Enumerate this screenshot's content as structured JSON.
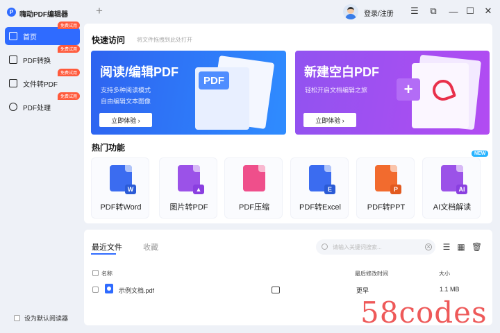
{
  "app": {
    "title": "嗨动PDF编辑器",
    "logo_glyph": "P",
    "new_tab": "+"
  },
  "header": {
    "login_label": "登录/注册"
  },
  "window_controls": {
    "menu": "☰",
    "restore": "⧉",
    "minimize": "—",
    "maximize": "☐",
    "close": "✕"
  },
  "sidebar": {
    "items": [
      {
        "label": "首页",
        "badge": "免费试用"
      },
      {
        "label": "PDF转换",
        "badge": "免费试用"
      },
      {
        "label": "文件转PDF",
        "badge": "免费试用"
      },
      {
        "label": "PDF处理",
        "badge": "免费试用"
      }
    ],
    "default_reader_label": "设为默认阅读器"
  },
  "quick_access": {
    "title": "快速访问",
    "subtitle": "将文件拖拽到此处打开",
    "banners": [
      {
        "title": "阅读/编辑PDF",
        "desc1": "支持多种阅读模式",
        "desc2": "自由编辑文本图像",
        "button": "立即体验 ›",
        "tag": "PDF"
      },
      {
        "title": "新建空白PDF",
        "desc1": "轻松开启文档编辑之旅",
        "button": "立即体验 ›",
        "tag": "+"
      }
    ]
  },
  "hot_features": {
    "title": "热门功能",
    "new_badge": "NEW",
    "items": [
      {
        "label": "PDF转Word",
        "sub": "W",
        "color": "#3b6cf0",
        "sub_color": "#2b5bd6"
      },
      {
        "label": "图片转PDF",
        "sub": "▲",
        "color": "#9b52e8",
        "sub_color": "#8a3fe0"
      },
      {
        "label": "PDF压缩",
        "sub": "",
        "color": "#ef4f8b",
        "sub_color": "#e53d7c"
      },
      {
        "label": "PDF转Excel",
        "sub": "E",
        "color": "#3b6cf0",
        "sub_color": "#2b5bd6"
      },
      {
        "label": "PDF转PPT",
        "sub": "P",
        "color": "#f26b2e",
        "sub_color": "#e25a1f"
      },
      {
        "label": "AI文档解读",
        "sub": "AI",
        "color": "#9b52e8",
        "sub_color": "#8a3fe0"
      }
    ]
  },
  "recent": {
    "tabs": [
      {
        "label": "最近文件"
      },
      {
        "label": "收藏"
      }
    ],
    "search_placeholder": "请输入关键词搜索...",
    "columns": {
      "name": "名称",
      "modified": "最后修改时间",
      "size": "大小"
    },
    "files": [
      {
        "name": "示例文档.pdf",
        "modified": "更早",
        "size": "1.1 MB"
      }
    ]
  },
  "watermark": "58codes"
}
